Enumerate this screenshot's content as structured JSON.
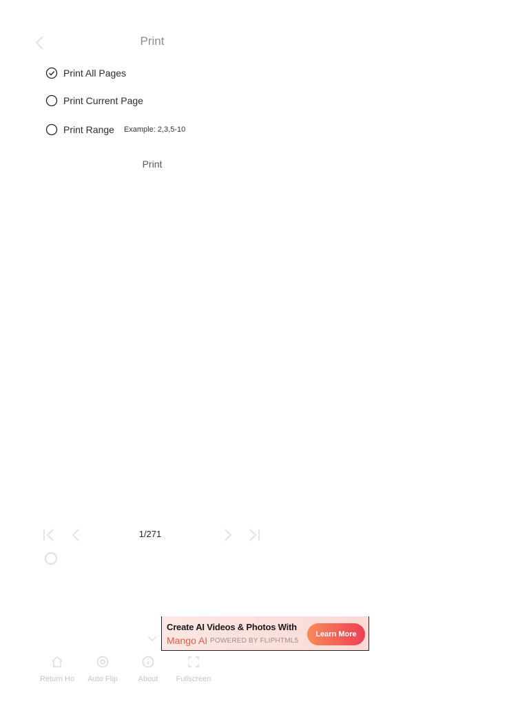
{
  "header": {
    "title": "Print"
  },
  "print_options": {
    "all_pages_label": "Print All Pages",
    "current_page_label": "Print Current Page",
    "range_label": "Print Range",
    "range_placeholder": "Example: 2,3,5-10",
    "selected": "Print All Pages"
  },
  "print_button_label": "Print",
  "pagination": {
    "current": 1,
    "total": 271,
    "indicator": "1/271"
  },
  "ad": {
    "headline": "Create AI Videos & Photos With",
    "brand": "Mango AI",
    "powered_by": "POWERED BY FLIPHTML5",
    "cta": "Learn More"
  },
  "toolbar": {
    "items": [
      {
        "label": "Return Ho",
        "icon": "home-icon"
      },
      {
        "label": "Auto Flip",
        "icon": "auto-flip-icon"
      },
      {
        "label": "About",
        "icon": "info-icon"
      },
      {
        "label": "Fullscreen",
        "icon": "fullscreen-icon"
      }
    ]
  },
  "colors": {
    "accent_cta_start": "#f98a5b",
    "accent_cta_end": "#ef3f55",
    "brand_text": "#f15a3a",
    "muted_icon": "#d9d9d9"
  }
}
